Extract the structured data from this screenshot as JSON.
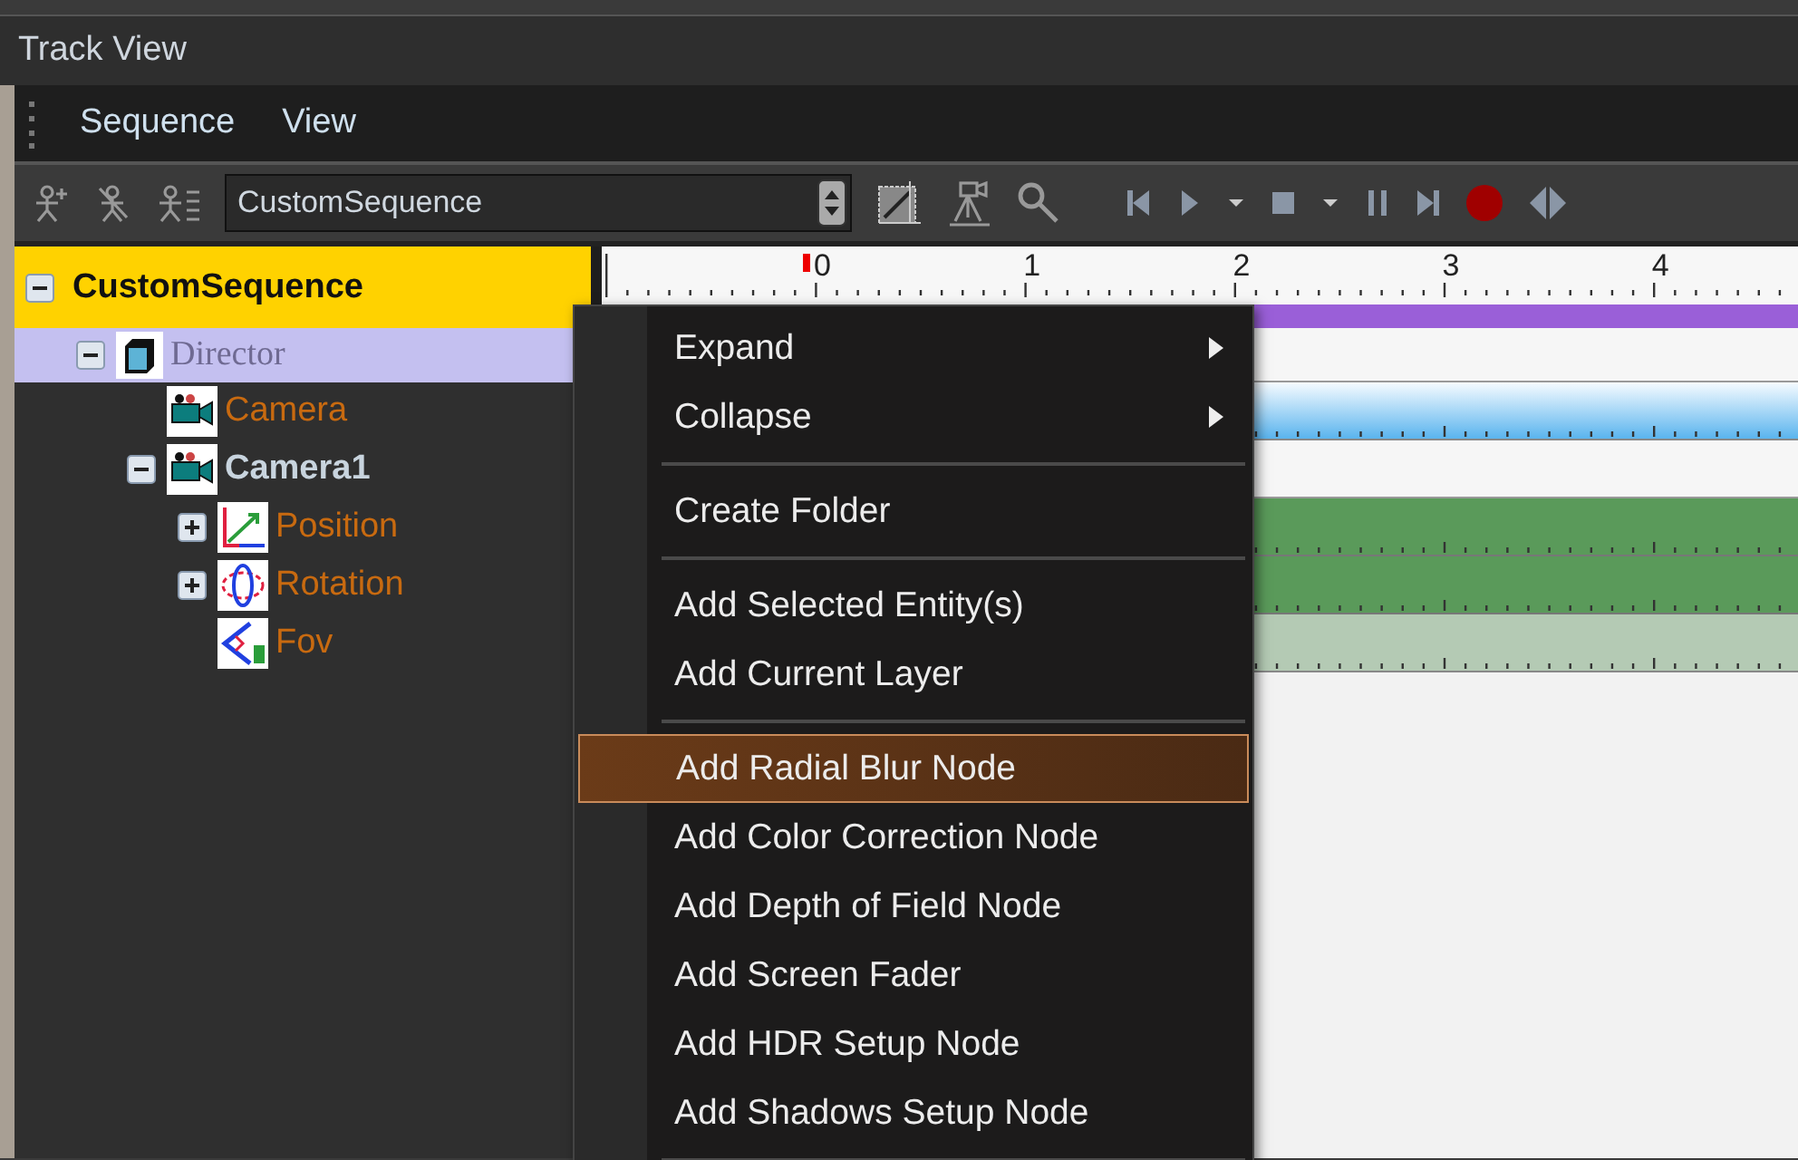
{
  "window": {
    "title": "Track View"
  },
  "menu_bar": [
    "Sequence",
    "View"
  ],
  "toolbar": {
    "sequence_select": {
      "value": "CustomSequence"
    }
  },
  "tree": [
    {
      "label": "CustomSequence",
      "kind": "sequence",
      "selected": true,
      "expanded": true,
      "children": [
        {
          "label": "Director",
          "kind": "director",
          "expanded": true,
          "children": [
            {
              "label": "Camera",
              "kind": "camera"
            },
            {
              "label": "Camera1",
              "kind": "entity",
              "expanded": true,
              "children": [
                {
                  "label": "Position",
                  "kind": "position",
                  "expanded": false
                },
                {
                  "label": "Rotation",
                  "kind": "rotation",
                  "expanded": false
                },
                {
                  "label": "Fov",
                  "kind": "fov"
                }
              ]
            }
          ]
        }
      ]
    }
  ],
  "ruler": [
    "0",
    "1",
    "2",
    "3",
    "4"
  ],
  "context_menu": [
    {
      "kind": "item",
      "label": "Expand",
      "submenu": true,
      "selected": false
    },
    {
      "kind": "item",
      "label": "Collapse",
      "submenu": true,
      "selected": false
    },
    {
      "kind": "separator"
    },
    {
      "kind": "item",
      "label": "Create Folder",
      "submenu": false,
      "selected": false
    },
    {
      "kind": "separator"
    },
    {
      "kind": "item",
      "label": "Add Selected Entity(s)",
      "submenu": false,
      "selected": false
    },
    {
      "kind": "item",
      "label": "Add Current Layer",
      "submenu": false,
      "selected": false
    },
    {
      "kind": "separator"
    },
    {
      "kind": "item",
      "label": "Add Radial Blur Node",
      "submenu": false,
      "selected": true
    },
    {
      "kind": "item",
      "label": "Add Color Correction Node",
      "submenu": false,
      "selected": false
    },
    {
      "kind": "item",
      "label": "Add Depth of Field Node",
      "submenu": false,
      "selected": false
    },
    {
      "kind": "item",
      "label": "Add Screen Fader",
      "submenu": false,
      "selected": false
    },
    {
      "kind": "item",
      "label": "Add HDR Setup Node",
      "submenu": false,
      "selected": false
    },
    {
      "kind": "item",
      "label": "Add Shadows Setup Node",
      "submenu": false,
      "selected": false
    },
    {
      "kind": "separator"
    }
  ]
}
